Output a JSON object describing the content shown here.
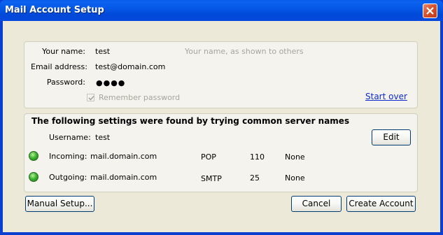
{
  "window": {
    "title": "Mail Account Setup"
  },
  "identity": {
    "name_label": "Your name:",
    "name_value": "test",
    "name_hint": "Your name, as shown to others",
    "email_label": "Email address:",
    "email_value": "test@domain.com",
    "password_label": "Password:",
    "password_value": "●●●●",
    "remember_label": "Remember password",
    "remember_checked": true,
    "start_over": "Start over"
  },
  "settings": {
    "heading": "The following settings were found by trying common server names",
    "username_label": "Username:",
    "username_value": "test",
    "edit_button": "Edit",
    "servers": [
      {
        "label": "Incoming:",
        "host": "mail.domain.com",
        "protocol": "POP",
        "port": "110",
        "security": "None",
        "status_color": "#2fa52a"
      },
      {
        "label": "Outgoing:",
        "host": "mail.domain.com",
        "protocol": "SMTP",
        "port": "25",
        "security": "None",
        "status_color": "#2fa52a"
      }
    ]
  },
  "buttons": {
    "manual_setup": "Manual Setup...",
    "cancel": "Cancel",
    "create_account": "Create Account"
  }
}
